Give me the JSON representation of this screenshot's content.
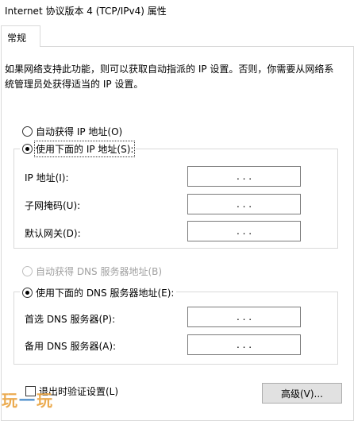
{
  "window": {
    "title": "Internet 协议版本 4 (TCP/IPv4) 属性"
  },
  "tabs": [
    {
      "label": "常规"
    }
  ],
  "description": "如果网络支持此功能，则可以获取自动指派的 IP 设置。否则，你需要从网络系统管理员处获得适当的 IP 设置。",
  "ip_section": {
    "auto_label": "自动获得 IP 地址(O)",
    "manual_label": "使用下面的 IP 地址(S):",
    "fields": [
      {
        "label": "IP 地址(I):",
        "value": ".  .  ."
      },
      {
        "label": "子网掩码(U):",
        "value": ".  .  ."
      },
      {
        "label": "默认网关(D):",
        "value": ".  .  ."
      }
    ]
  },
  "dns_section": {
    "auto_label": "自动获得 DNS 服务器地址(B)",
    "manual_label": "使用下面的 DNS 服务器地址(E):",
    "fields": [
      {
        "label": "首选 DNS 服务器(P):",
        "value": ".  .  ."
      },
      {
        "label": "备用 DNS 服务器(A):",
        "value": ".  .  ."
      }
    ]
  },
  "footer": {
    "validate_label": "退出时验证设置(L)",
    "advanced_label": "高级(V)..."
  },
  "watermark": {
    "text_a": "玩",
    "text_b": "一",
    "text_c": "玩"
  }
}
